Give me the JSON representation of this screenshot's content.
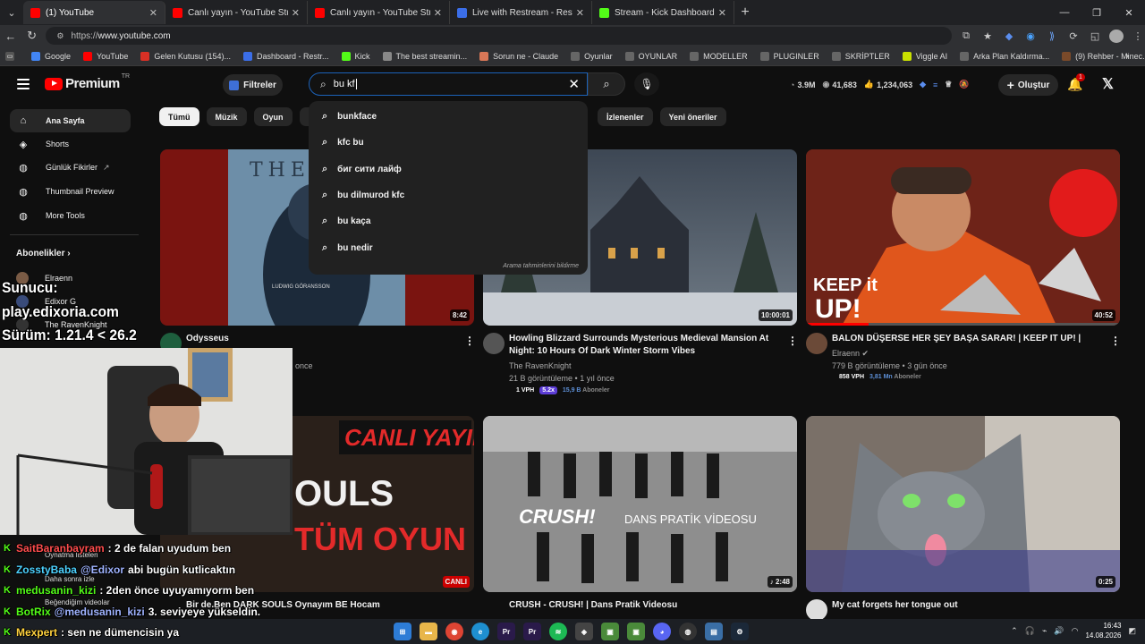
{
  "browser": {
    "tabs": [
      {
        "title": "(1) YouTube",
        "color": "#ff0000",
        "active": true
      },
      {
        "title": "Canlı yayın - YouTube Studio",
        "color": "#ff0000",
        "active": false
      },
      {
        "title": "Canlı yayın - YouTube Studio",
        "color": "#ff0000",
        "active": false
      },
      {
        "title": "Live with Restream - Restream",
        "color": "#3b6ee8",
        "active": false
      },
      {
        "title": "Stream - Kick Dashboard",
        "color": "#53fc18",
        "active": false
      }
    ],
    "url_scheme": "https://",
    "url_host": "www.youtube.com",
    "bookmarks": [
      {
        "label": "Google",
        "color": "#4285f4"
      },
      {
        "label": "YouTube",
        "color": "#ff0000"
      },
      {
        "label": "Gelen Kutusu (154)...",
        "color": "#d93025"
      },
      {
        "label": "Dashboard - Restr...",
        "color": "#3b6ee8"
      },
      {
        "label": "Kick",
        "color": "#53fc18"
      },
      {
        "label": "The best streamin...",
        "color": "#888888"
      },
      {
        "label": "Sorun ne - Claude",
        "color": "#d97757"
      },
      {
        "label": "Oyunlar",
        "color": "#666666"
      },
      {
        "label": "OYUNLAR",
        "color": "#666666"
      },
      {
        "label": "MODELLER",
        "color": "#666666"
      },
      {
        "label": "PLUGINLER",
        "color": "#666666"
      },
      {
        "label": "SKRİPTLER",
        "color": "#666666"
      },
      {
        "label": "Viggle AI",
        "color": "#c9e000"
      },
      {
        "label": "Arka Plan Kaldırma...",
        "color": "#666666"
      },
      {
        "label": "(9) Rehber - Minec...",
        "color": "#7a4a2a"
      }
    ]
  },
  "youtube": {
    "logo_text": "Premium",
    "country": "TR",
    "filters_label": "Filtreler",
    "search_value": "bu kf",
    "stats": {
      "subs": "3.9M",
      "views": "41,683",
      "likes": "1,234,063"
    },
    "create_label": "Oluştur",
    "notif_count": "1",
    "suggestions": [
      "bunkface",
      "kfc bu",
      "биг сити лайф",
      "bu dilmurod kfc",
      "bu kaça",
      "bu nedir"
    ],
    "suggest_report": "Arama tahminlerini bildirme",
    "sidebar": {
      "items": [
        {
          "label": "Ana Sayfa",
          "icon": "home-icon"
        },
        {
          "label": "Shorts",
          "icon": "shorts-icon"
        },
        {
          "label": "Günlük Fikirler",
          "icon": "lightbulb-icon"
        },
        {
          "label": "Thumbnail Preview",
          "icon": "image-icon"
        },
        {
          "label": "More Tools",
          "icon": "tools-icon"
        }
      ],
      "subs_title": "Abonelikler",
      "subs": [
        "Elraenn",
        "Edixor G",
        "The RavenKnight"
      ]
    },
    "chips": [
      "Tümü",
      "Müzik",
      "Oyun",
      "Mix"
    ],
    "chips_right": [
      "İzlenenler",
      "Yeni öneriler"
    ],
    "videos": [
      {
        "title": "Odysseus",
        "channel": "",
        "meta": "once",
        "duration": "8:42",
        "thumb_text": "THE O",
        "thumb_sub": "LUDWIG GÖRANSSON"
      },
      {
        "title": "Howling Blizzard Surrounds Mysterious Medieval Mansion At Night: 10 Hours Of Dark Winter Storm Vibes",
        "channel": "The RavenKnight",
        "meta": "21 B görüntüleme • 1 yıl önce",
        "duration": "10:00:01",
        "badges": {
          "vph": "1 VPH",
          "mult": "5.2x",
          "subs": "15,9 B",
          "subs_label": "Aboneler"
        }
      },
      {
        "title": "BALON DÜŞERSE HER ŞEY BAŞA SARAR! | KEEP IT UP! |",
        "channel": "Elraenn",
        "meta": "779 B görüntüleme • 3 gün önce",
        "duration": "40:52",
        "thumb_text": "KEEP it UP!",
        "badges": {
          "vph": "858 VPH",
          "subs": "3,81 Mn",
          "subs_label": "Aboneler"
        }
      },
      {
        "title": "Bir de.Ben DARK SOULS Oynayım BE Hocam",
        "channel": "",
        "meta": "",
        "duration": "CANLI",
        "thumb_text": "CANLI YAYIN",
        "thumb_sub": "SOULS TÜM OYUN"
      },
      {
        "title": "CRUSH - CRUSH! | Dans Pratik Videosu",
        "channel": "",
        "meta": "",
        "duration": "2:48",
        "thumb_text": "CRUSH!",
        "thumb_sub": "DANS PRATİK VİDEOSU"
      },
      {
        "title": "My cat forgets her tongue out",
        "channel": "",
        "meta": "",
        "duration": "0:25"
      }
    ]
  },
  "overlay": {
    "server_lines": [
      "Sunucu:",
      "play.edixoria.com",
      "Sürüm: 1.21.4 < 26.2"
    ],
    "library_items": [
      "Oynatma listeleri",
      "Daha sonra izle",
      "Beğendiğim videolar"
    ],
    "chat": [
      {
        "user": "SaitBaranbayram",
        "user_color": "#ff4d4d",
        "mention": "",
        "text": ": 2 de falan uyudum ben"
      },
      {
        "user": "ZosstyBaba",
        "user_color": "#4dd2ff",
        "mention": "@Edixor",
        "text": "abi bugün kutlicaktın"
      },
      {
        "user": "medusanin_kizi",
        "user_color": "#53fc18",
        "mention": "",
        "text": ": 2den önce uyuyamıyorm ben"
      },
      {
        "user": "BotRix",
        "user_color": "#53fc18",
        "mention": "@medusanin_kizi",
        "text": "3. seviyeye yükseldin."
      },
      {
        "user": "Mexpert",
        "user_color": "#ffd23f",
        "mention": "",
        "text": ": sen ne dümencisin ya"
      }
    ]
  },
  "taskbar": {
    "time": "16:43",
    "date": "14.08.2026"
  }
}
